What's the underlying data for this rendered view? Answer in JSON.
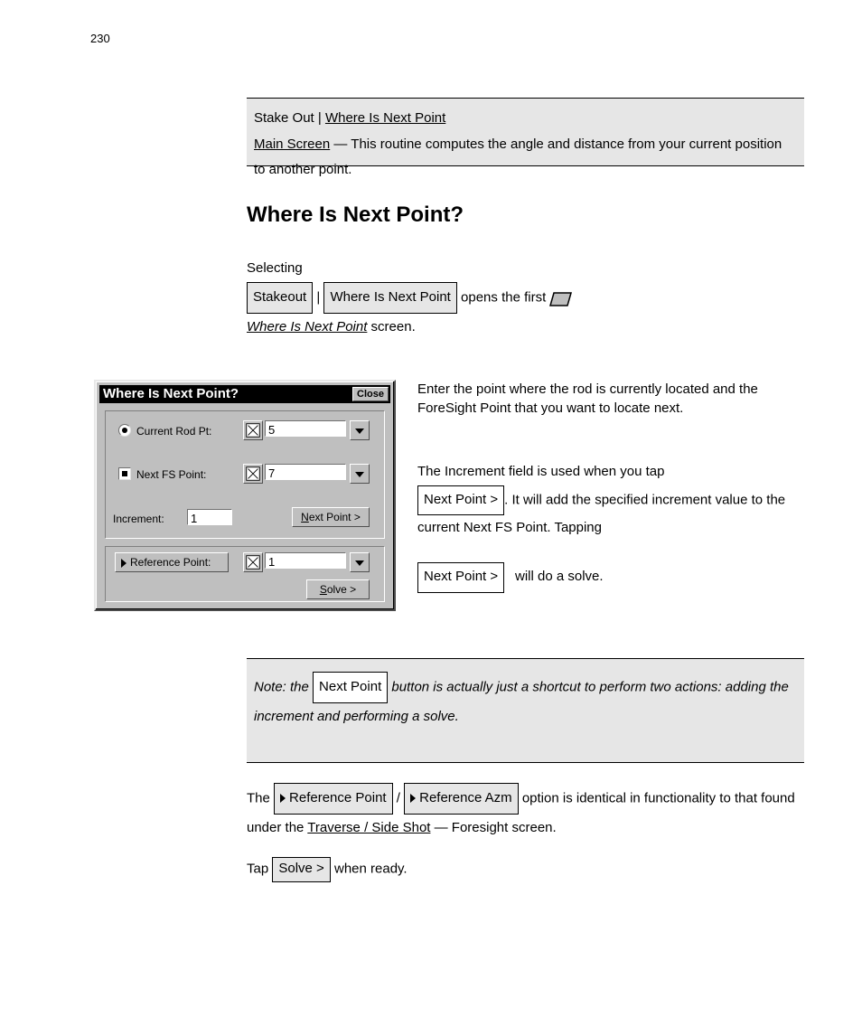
{
  "page_number": "230",
  "banner1": {
    "prefix": "Stake Out | ",
    "link": "Where Is Next Point",
    "line2_link": "Main Screen",
    "desc": " — This routine computes the angle and distance from your current position to another point."
  },
  "section_heading": "Where Is Next Point?",
  "para1_before": "Selecting ",
  "para1_mid": " | ",
  "para1_after": " opens the first ",
  "para1_end": " screen.",
  "btn_stakeout": "Stakeout",
  "btn_where_next": "Where Is Next Point",
  "wisp_title_italic": "Where Is Next Point",
  "para2": "Enter the point where the rod is currently located and the ForeSight Point that you want to locate next.",
  "para3_a": "The Increment field is used when you tap ",
  "para3_b": ". It will add the specified increment value to the current Next FS Point. Tapping ",
  "para3_c": " will do a solve.",
  "btn_next_point_gt": "Next Point >",
  "banner2": {
    "prefix": "Note: the ",
    "mid": " button is actually just a shortcut to perform two actions: adding the increment and performing a solve.",
    "btn": "Next Point"
  },
  "para4_a": "The ",
  "para4_b": " / ",
  "para4_c": " option is identical in functionality to that found under the ",
  "para4_d": " — Foresight screen.",
  "btn_ref_point": "Reference Point",
  "btn_ref_azm": "Reference Azm",
  "traverse_side_shot": "Traverse / Side Shot",
  "para5_a": "Tap ",
  "para5_b": " when ready.",
  "btn_solve": "Solve >",
  "dialog": {
    "title": "Where Is Next Point?",
    "close": "Close",
    "current_rod_label": "Current Rod Pt:",
    "current_rod_value": "5",
    "next_fs_label": "Next FS Point:",
    "next_fs_value": "7",
    "increment_label": "Increment:",
    "increment_value": "1",
    "next_point_btn": "Next Point >",
    "ref_point_btn": "Reference Point:",
    "ref_point_value": "1",
    "solve_btn": "Solve >"
  }
}
